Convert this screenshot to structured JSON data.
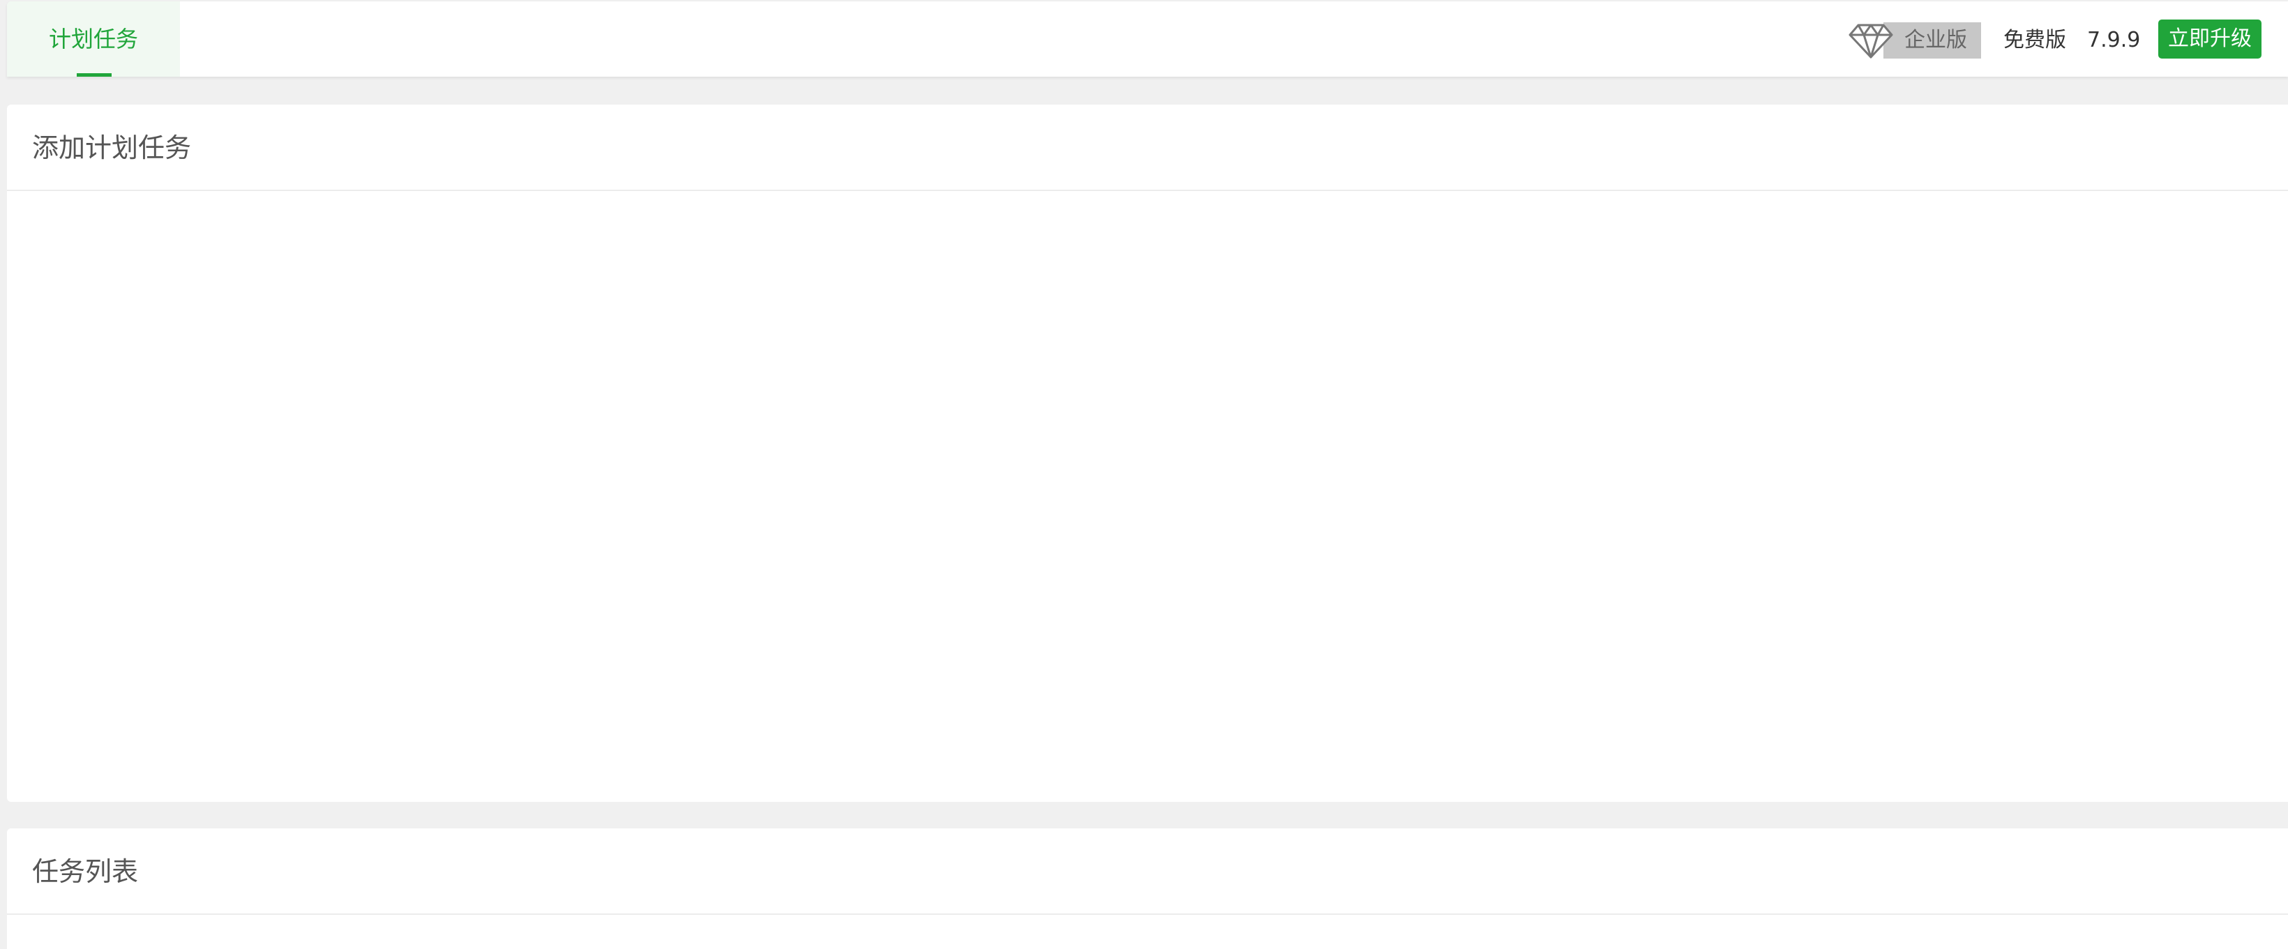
{
  "topbar": {
    "tab_label": "计划任务",
    "edition_badge": "企业版",
    "free_label": "免费版",
    "version": "7.9.9",
    "upgrade_button": "立即升级",
    "icons": {
      "edition": "diamond-icon"
    },
    "colors": {
      "accent": "#20a53a",
      "badge_bg": "#c7c7c7"
    }
  },
  "add_task_panel": {
    "title": "添加计划任务"
  },
  "task_list_panel": {
    "title": "任务列表"
  }
}
